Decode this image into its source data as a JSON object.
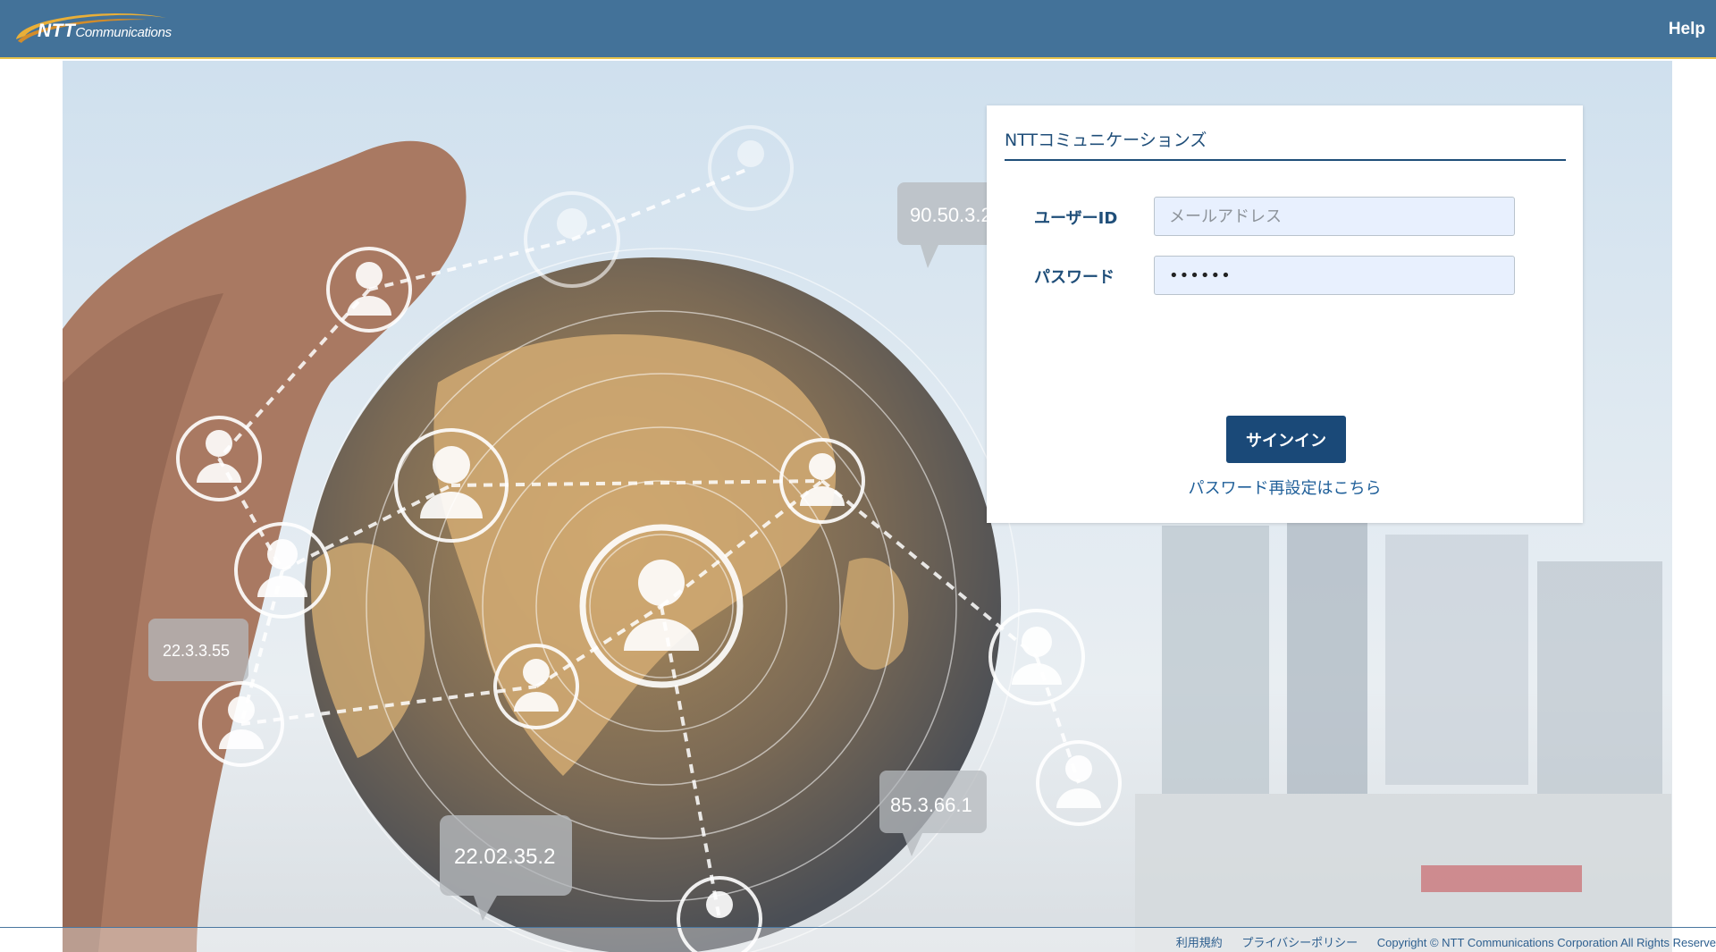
{
  "header": {
    "logo_ntt": "NTT",
    "logo_comm": "Communications",
    "help_label": "Help"
  },
  "hero": {
    "ip_tags": [
      "90.50.3.2",
      "22.3.3.55",
      "22.02.35.2",
      "85.3.66.1"
    ]
  },
  "login": {
    "title": "NTTコミュニケーションズ",
    "user_label": "ユーザーID",
    "user_placeholder": "メールアドレス",
    "user_value": "",
    "password_label": "パスワード",
    "password_value": "••••••",
    "signin_label": "サインイン",
    "reset_link": "パスワード再設定はこちら"
  },
  "footer": {
    "terms": "利用規約",
    "privacy": "プライバシーポリシー",
    "copyright": "Copyright © NTT Communications Corporation All Rights Reserve"
  },
  "colors": {
    "header_bg": "#437299",
    "header_accent": "#e7c24a",
    "primary": "#1a4978",
    "link": "#1f5f99"
  }
}
